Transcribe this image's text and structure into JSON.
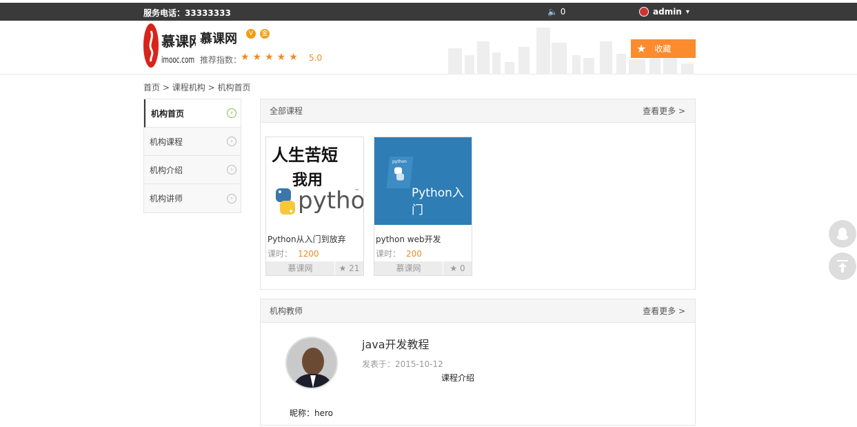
{
  "topbar": {
    "phone": "服务电话：33333333",
    "message_icon": "speaker-icon",
    "message_count": "0",
    "username": "admin",
    "caret": "▾"
  },
  "header": {
    "logo_text_cn": "慕课网",
    "logo_text_en": "imooc.com",
    "org_name": "慕课网",
    "rating_label": "推荐指数：",
    "stars": "★★★★★",
    "score": "5.0",
    "favorite_label": "收藏"
  },
  "breadcrumb": {
    "home": "首页",
    "sep1": ">",
    "orgs": "课程机构",
    "sep2": ">",
    "current": "机构首页"
  },
  "sidebar": {
    "items": [
      {
        "label": "机构首页",
        "active": true
      },
      {
        "label": "机构课程",
        "active": false
      },
      {
        "label": "机构介绍",
        "active": false
      },
      {
        "label": "机构讲师",
        "active": false
      }
    ]
  },
  "courses_panel": {
    "title": "全部课程",
    "more": "查看更多 >",
    "courses": [
      {
        "image_text_line1": "人生苦短",
        "image_text_line2": "我用",
        "image_text_logo": "python",
        "image_tm": "™",
        "title": "Python从入门到放弃",
        "hours_label": "课时：",
        "hours": "1200",
        "org": "慕课网",
        "favorites": "21"
      },
      {
        "image_text_small": "python",
        "image_text_main": "Python入门",
        "title": "python web开发",
        "hours_label": "课时：",
        "hours": "200",
        "org": "慕课网",
        "favorites": "0"
      }
    ]
  },
  "teachers_panel": {
    "title": "机构教师",
    "more": "查看更多 >",
    "teacher": {
      "nickname": "昵称：hero",
      "course_title": "java开发教程",
      "published": "发表于：2015-10-12",
      "course_intro": "课程介绍"
    }
  },
  "colors": {
    "accent_orange": "#fb8b2c",
    "topbar_bg": "#3a3a3a",
    "python_blue_bg": "#2e7db4"
  }
}
